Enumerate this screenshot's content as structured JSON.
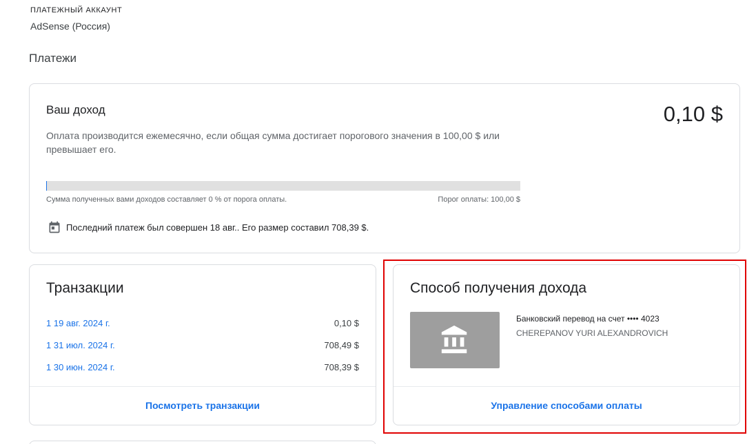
{
  "account": {
    "label": "ПЛАТЕЖНЫЙ АККАУНТ",
    "name": "AdSense (Россия)"
  },
  "section_title": "Платежи",
  "income": {
    "title": "Ваш доход",
    "amount": "0,10 $",
    "description": "Оплата производится ежемесячно, если общая сумма достигает порогового значения в 100,00 $ или превышает его.",
    "progress_fraction": 0.001,
    "progress_text": "Сумма полученных вами доходов составляет 0 % от порога оплаты.",
    "threshold_text": "Порог оплаты: 100,00 $",
    "last_payment_icon": "calendar-icon",
    "last_payment": "Последний платеж был совершен 18 авг.. Его размер составил 708,39 $."
  },
  "transactions": {
    "title": "Транзакции",
    "rows": [
      {
        "date": "1  19 авг. 2024 г.",
        "amount": "0,10 $"
      },
      {
        "date": "1  31 июл. 2024 г.",
        "amount": "708,49 $"
      },
      {
        "date": "1  30 июн. 2024 г.",
        "amount": "708,39 $"
      }
    ],
    "link": "Посмотреть транзакции"
  },
  "payment_method": {
    "title": "Способ получения дохода",
    "icon": "bank-icon",
    "line1": "Банковский перевод на счет  •••• 4023",
    "line2": "CHEREPANOV YURI ALEXANDROVICH",
    "link": "Управление способами оплаты"
  },
  "colors": {
    "link": "#1a73e8",
    "highlight": "#e00000",
    "bank_bg": "#9e9e9e",
    "track": "#e0e0e0"
  }
}
